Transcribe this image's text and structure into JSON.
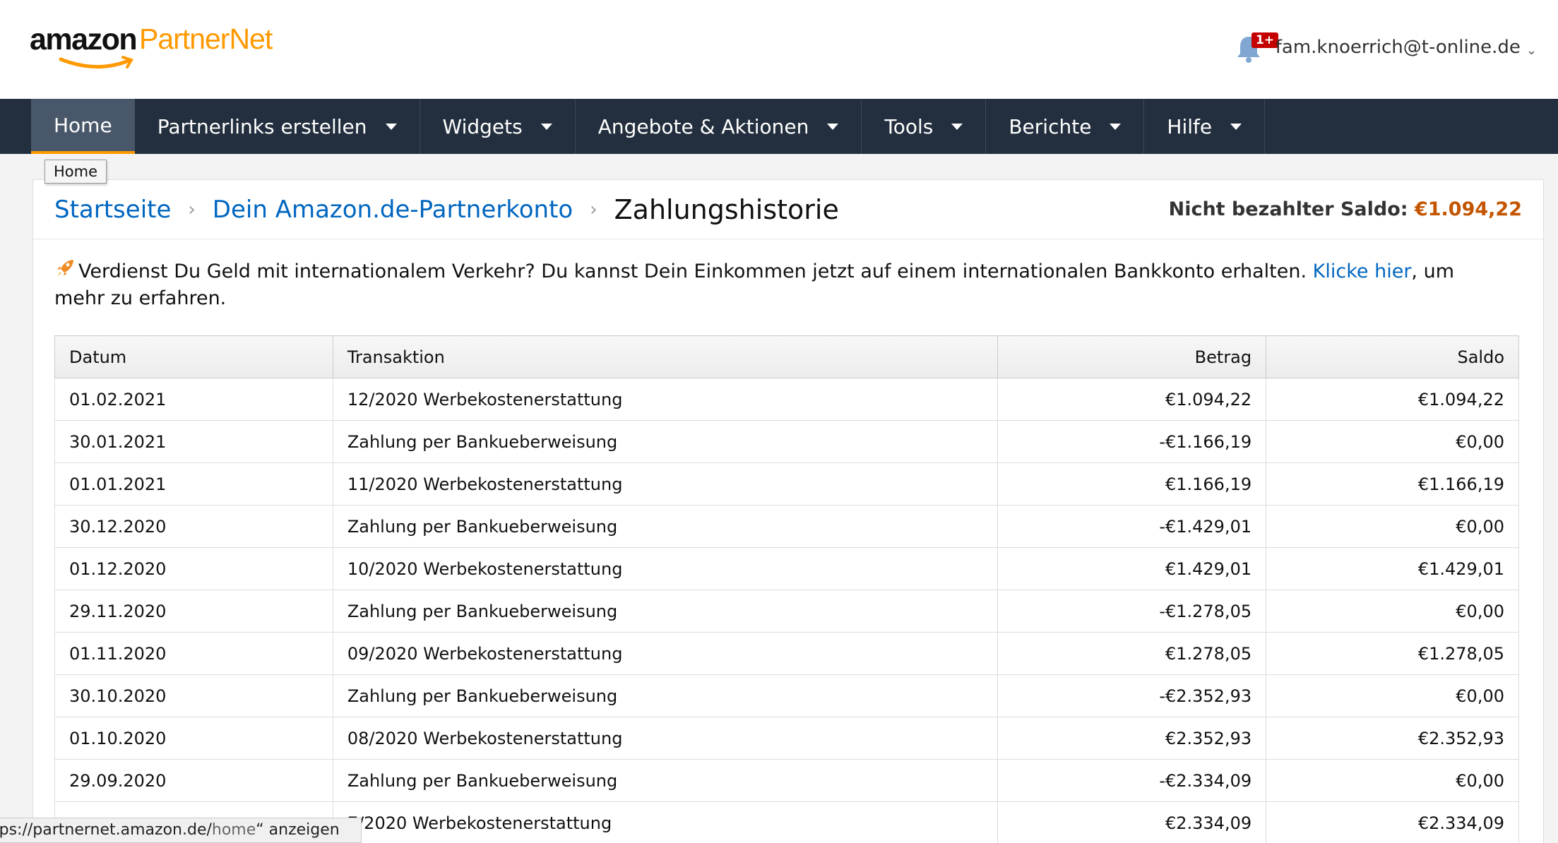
{
  "brand": {
    "logo_amazon": "amazon",
    "logo_partner": "PartnerNet"
  },
  "header": {
    "notification_count": "1+",
    "user_email": "fam.knoerrich@t-online.de"
  },
  "nav": {
    "items": [
      {
        "label": "Home"
      },
      {
        "label": "Partnerlinks erstellen"
      },
      {
        "label": "Widgets"
      },
      {
        "label": "Angebote & Aktionen"
      },
      {
        "label": "Tools"
      },
      {
        "label": "Berichte"
      },
      {
        "label": "Hilfe"
      }
    ],
    "tooltip": "Home"
  },
  "breadcrumb": {
    "home": "Startseite",
    "account": "Dein Amazon.de-Partnerkonto",
    "current": "Zahlungshistorie"
  },
  "balance": {
    "label": "Nicht bezahlter Saldo:",
    "value": "€1.094,22"
  },
  "info": {
    "text_before": "Verdienst Du Geld mit internationalem Verkehr? Du kannst Dein Einkommen jetzt auf einem internationalen Bankkonto erhalten.",
    "link": "Klicke hier",
    "text_after": ", um mehr zu erfahren."
  },
  "table": {
    "headers": {
      "date": "Datum",
      "transaction": "Transaktion",
      "amount": "Betrag",
      "balance": "Saldo"
    },
    "rows": [
      {
        "date": "01.02.2021",
        "transaction": "12/2020 Werbekostenerstattung",
        "amount": "€1.094,22",
        "balance": "€1.094,22"
      },
      {
        "date": "30.01.2021",
        "transaction": "Zahlung per Bankueberweisung",
        "amount": "-€1.166,19",
        "balance": "€0,00"
      },
      {
        "date": "01.01.2021",
        "transaction": "11/2020 Werbekostenerstattung",
        "amount": "€1.166,19",
        "balance": "€1.166,19"
      },
      {
        "date": "30.12.2020",
        "transaction": "Zahlung per Bankueberweisung",
        "amount": "-€1.429,01",
        "balance": "€0,00"
      },
      {
        "date": "01.12.2020",
        "transaction": "10/2020 Werbekostenerstattung",
        "amount": "€1.429,01",
        "balance": "€1.429,01"
      },
      {
        "date": "29.11.2020",
        "transaction": "Zahlung per Bankueberweisung",
        "amount": "-€1.278,05",
        "balance": "€0,00"
      },
      {
        "date": "01.11.2020",
        "transaction": "09/2020 Werbekostenerstattung",
        "amount": "€1.278,05",
        "balance": "€1.278,05"
      },
      {
        "date": "30.10.2020",
        "transaction": "Zahlung per Bankueberweisung",
        "amount": "-€2.352,93",
        "balance": "€0,00"
      },
      {
        "date": "01.10.2020",
        "transaction": "08/2020 Werbekostenerstattung",
        "amount": "€2.352,93",
        "balance": "€2.352,93"
      },
      {
        "date": "29.09.2020",
        "transaction": "Zahlung per Bankueberweisung",
        "amount": "-€2.334,09",
        "balance": "€0,00"
      },
      {
        "date": "",
        "transaction": "7/2020 Werbekostenerstattung",
        "amount": "€2.334,09",
        "balance": "€2.334,09"
      }
    ]
  },
  "statusbar": {
    "url_host": "tps://partnernet.amazon.de/",
    "url_path": "home",
    "suffix": "“ anzeigen"
  },
  "colors": {
    "nav_bg": "#232f3e",
    "accent": "#ff9900",
    "link": "#0066c0",
    "negative": "#b12704",
    "balance": "#c45500"
  }
}
